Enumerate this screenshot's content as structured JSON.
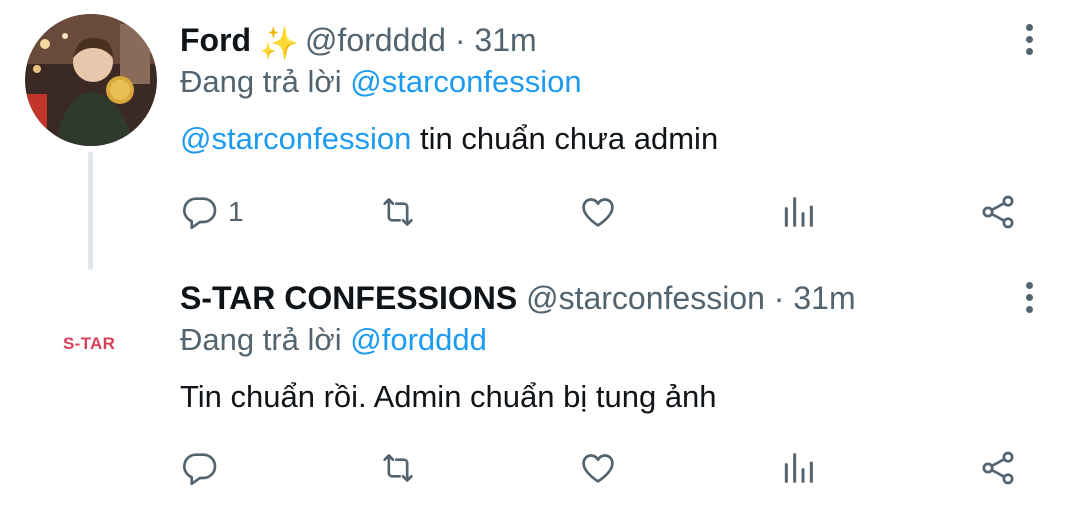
{
  "tweets": [
    {
      "name": "Ford",
      "emoji": "✨",
      "handle": "@fordddd",
      "separator": "·",
      "time": "31m",
      "reply_prefix": "Đang trả lời",
      "reply_to": "@starconfession",
      "mention": "@starconfession",
      "text": " tin chuẩn chưa admin",
      "reply_count": "1"
    },
    {
      "name": "S-TAR CONFESSIONS",
      "handle": "@starconfession",
      "separator": "·",
      "time": "31m",
      "avatar_text": "S-TAR",
      "reply_prefix": "Đang trả lời",
      "reply_to": "@fordddd",
      "text": "Tin chuẩn rồi. Admin chuẩn bị tung ảnh"
    }
  ],
  "icons": [
    "reply-icon",
    "retweet-icon",
    "like-icon",
    "analytics-icon",
    "share-icon",
    "more-options-icon"
  ],
  "colors": {
    "link": "#1d9bf0",
    "muted": "#536471",
    "logo": "#d64059",
    "text": "#0f1419"
  }
}
